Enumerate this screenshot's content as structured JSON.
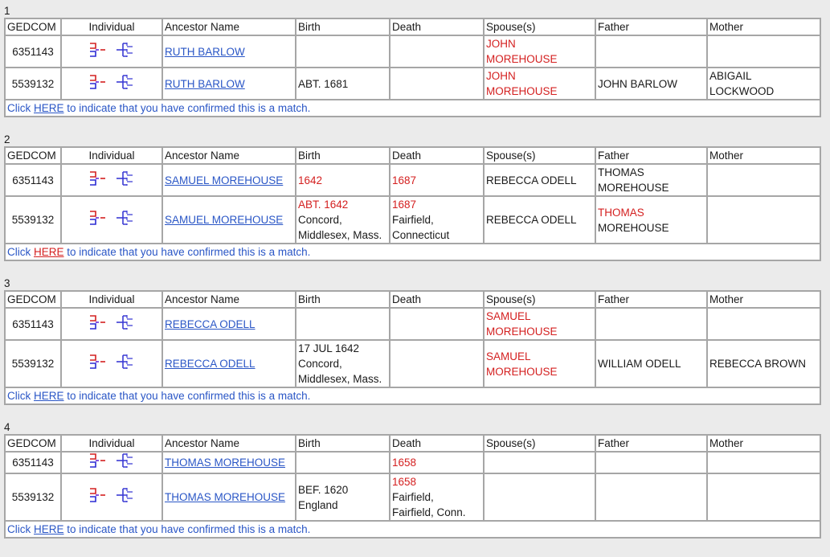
{
  "columns": [
    "GEDCOM",
    "Individual",
    "Ancestor Name",
    "Birth",
    "Death",
    "Spouse(s)",
    "Father",
    "Mother"
  ],
  "confirm": {
    "pre": "Click ",
    "link": "HERE",
    "post": " to indicate that you have confirmed this is a match."
  },
  "icons": {
    "pedigree": "pedigree-chart-icon",
    "descendant": "descendant-chart-icon"
  },
  "colors": {
    "link": "#2a56c6",
    "highlight": "#d42020",
    "border": "#a6a6a6",
    "background": "#ebebeb"
  },
  "groups": [
    {
      "number": "1",
      "rows": [
        {
          "gedcom": "6351143",
          "name": "RUTH BARLOW",
          "birth": [],
          "death": [],
          "spouse": [
            "JOHN",
            "MOREHOUSE"
          ],
          "father": [],
          "mother": [],
          "hl": {
            "birth": false,
            "death": false,
            "spouse": true,
            "father": false,
            "mother": false
          }
        },
        {
          "gedcom": "5539132",
          "name": "RUTH BARLOW",
          "birth": [
            "ABT. 1681"
          ],
          "death": [],
          "spouse": [
            "JOHN",
            "MOREHOUSE"
          ],
          "father": [
            "JOHN BARLOW"
          ],
          "mother": [
            "ABIGAIL",
            "LOCKWOOD"
          ],
          "hl": {
            "birth": false,
            "death": false,
            "spouse": true,
            "father": false,
            "mother": false
          }
        }
      ]
    },
    {
      "number": "2",
      "confirm_hover": true,
      "rows": [
        {
          "gedcom": "6351143",
          "name": "SAMUEL MOREHOUSE",
          "birth": [
            "1642"
          ],
          "death": [
            "1687"
          ],
          "spouse": [
            "REBECCA ODELL"
          ],
          "father": [
            "THOMAS",
            "MOREHOUSE"
          ],
          "mother": [],
          "hl": {
            "birth": true,
            "death": true,
            "spouse": false,
            "father": false,
            "mother": false
          }
        },
        {
          "gedcom": "5539132",
          "name": "SAMUEL MOREHOUSE",
          "birth": [
            "ABT. 1642",
            "Concord,",
            "Middlesex, Mass."
          ],
          "death": [
            "1687",
            "Fairfield,",
            "Connecticut"
          ],
          "spouse": [
            "REBECCA ODELL"
          ],
          "father": [
            "THOMAS",
            "MOREHOUSE"
          ],
          "mother": [],
          "hl": {
            "birth": true,
            "death": true,
            "spouse": false,
            "father": true,
            "mother": false
          }
        }
      ]
    },
    {
      "number": "3",
      "rows": [
        {
          "gedcom": "6351143",
          "name": "REBECCA ODELL",
          "birth": [],
          "death": [],
          "spouse": [
            "SAMUEL",
            "MOREHOUSE"
          ],
          "father": [],
          "mother": [],
          "hl": {
            "birth": false,
            "death": false,
            "spouse": true,
            "father": false,
            "mother": false
          }
        },
        {
          "gedcom": "5539132",
          "name": "REBECCA ODELL",
          "birth": [
            "17 JUL 1642",
            "Concord,",
            "Middlesex, Mass."
          ],
          "death": [],
          "spouse": [
            "SAMUEL",
            "MOREHOUSE"
          ],
          "father": [
            "WILLIAM ODELL"
          ],
          "mother": [
            "REBECCA BROWN"
          ],
          "hl": {
            "birth": false,
            "death": false,
            "spouse": true,
            "father": false,
            "mother": false
          }
        }
      ]
    },
    {
      "number": "4",
      "rows": [
        {
          "gedcom": "6351143",
          "name": "THOMAS MOREHOUSE",
          "birth": [],
          "death": [
            "1658"
          ],
          "spouse": [],
          "father": [],
          "mother": [],
          "hl": {
            "birth": false,
            "death": true,
            "spouse": false,
            "father": false,
            "mother": false
          }
        },
        {
          "gedcom": "5539132",
          "name": "THOMAS MOREHOUSE",
          "birth": [
            "BEF. 1620",
            "England"
          ],
          "death": [
            "1658",
            "Fairfield,",
            "Fairfield, Conn."
          ],
          "spouse": [],
          "father": [],
          "mother": [],
          "hl": {
            "birth": false,
            "death": true,
            "spouse": false,
            "father": false,
            "mother": false
          }
        }
      ]
    }
  ]
}
